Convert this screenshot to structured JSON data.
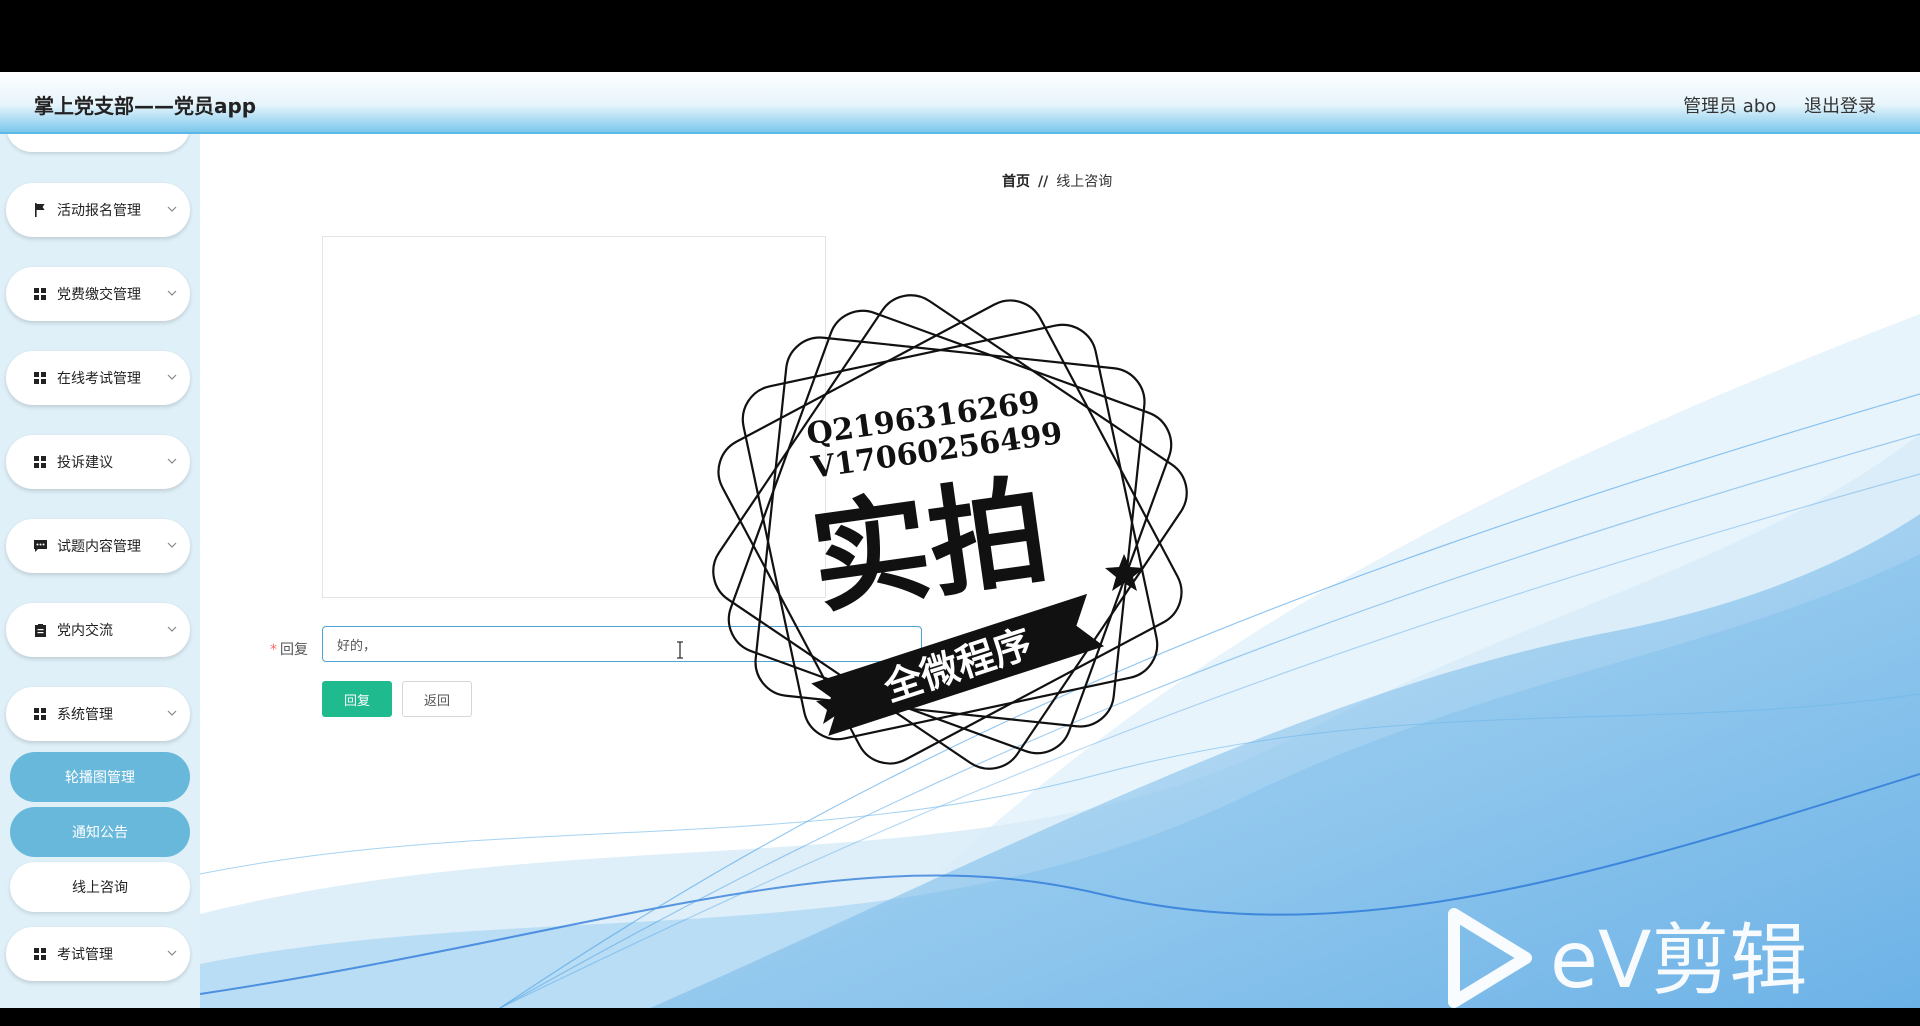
{
  "app": {
    "title": "掌上党支部——党员app",
    "user_label": "管理员 abo",
    "logout_label": "退出登录"
  },
  "sidebar": {
    "menus": [
      {
        "label": "活动报名管理",
        "icon": "flag-icon"
      },
      {
        "label": "党费缴交管理",
        "icon": "grid-icon"
      },
      {
        "label": "在线考试管理",
        "icon": "grid-icon"
      },
      {
        "label": "投诉建议",
        "icon": "grid-icon"
      },
      {
        "label": "试题内容管理",
        "icon": "chat-icon"
      },
      {
        "label": "党内交流",
        "icon": "clipboard-icon"
      },
      {
        "label": "系统管理",
        "icon": "grid-icon"
      }
    ],
    "submenu": [
      "轮播图管理",
      "通知公告",
      "线上咨询"
    ],
    "last_menu": {
      "label": "考试管理",
      "icon": "grid-icon"
    }
  },
  "breadcrumb": {
    "home": "首页",
    "separator": "//",
    "current": "线上咨询"
  },
  "form": {
    "reply_label": "回复",
    "required_mark": "*",
    "reply_value": "好的，",
    "submit_label": "回复",
    "back_label": "返回"
  },
  "watermark": {
    "line1": "Q2196316269",
    "line2": "V17060256499",
    "big_text": "实拍",
    "ribbon_text": "全微程序"
  },
  "overlay": {
    "brand": "eV剪辑"
  },
  "colors": {
    "accent": "#68b8dc",
    "primary_button": "#1fbb8f",
    "header_border": "#5cb8e6"
  }
}
